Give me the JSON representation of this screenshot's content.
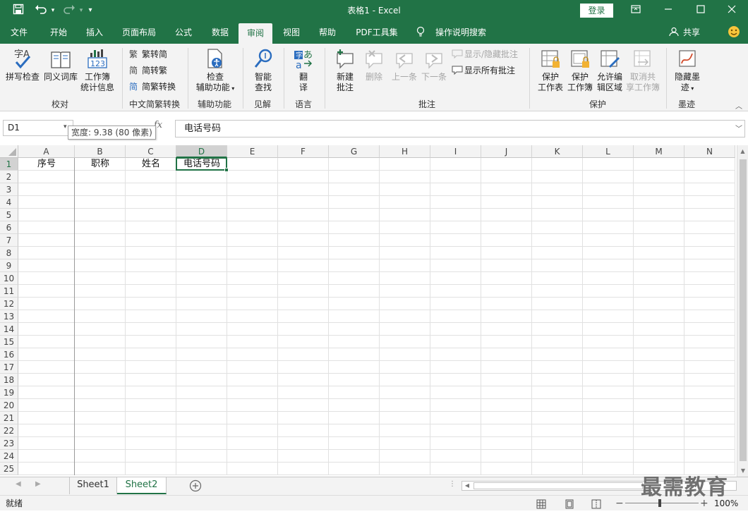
{
  "titlebar": {
    "title": "表格1 - Excel",
    "login": "登录",
    "qat": {
      "save_icon": "save-icon",
      "undo_icon": "undo-icon",
      "redo_icon": "redo-icon",
      "customize_icon": "qat-customize-icon"
    }
  },
  "tabs": [
    "文件",
    "开始",
    "插入",
    "页面布局",
    "公式",
    "数据",
    "审阅",
    "视图",
    "帮助",
    "PDF工具集",
    "操作说明搜索"
  ],
  "active_tab": "审阅",
  "share_label": "共享",
  "ribbon": {
    "proofing": {
      "label": "校对",
      "spell": "拼写检查",
      "thesaurus": "同义词库",
      "stats_line1": "工作簿",
      "stats_line2": "统计信息"
    },
    "chinese": {
      "label": "中文简繁转换",
      "to_simplified": "繁转简",
      "to_traditional": "简转繁",
      "convert": "简繁转换"
    },
    "accessibility": {
      "label": "辅助功能",
      "check_line1": "检查",
      "check_line2": "辅助功能"
    },
    "insights": {
      "label": "见解",
      "smart_line1": "智能",
      "smart_line2": "查找"
    },
    "language": {
      "label": "语言",
      "translate_line1": "翻",
      "translate_line2": "译"
    },
    "comments": {
      "label": "批注",
      "new_line1": "新建",
      "new_line2": "批注",
      "delete": "删除",
      "prev": "上一条",
      "next": "下一条",
      "show_hide": "显示/隐藏批注",
      "show_all": "显示所有批注"
    },
    "protect": {
      "label": "保护",
      "sheet_line1": "保护",
      "sheet_line2": "工作表",
      "book_line1": "保护",
      "book_line2": "工作簿",
      "allow_line1": "允许编",
      "allow_line2": "辑区域",
      "unshare_line1": "取消共",
      "unshare_line2": "享工作簿"
    },
    "ink": {
      "label": "墨迹",
      "hide_line1": "隐藏墨",
      "hide_line2": "迹"
    }
  },
  "formula_bar": {
    "name_box": "D1",
    "fx": "fx",
    "content": "电话号码"
  },
  "tooltip": {
    "text": "宽度: 9.38 (80 像素)"
  },
  "grid": {
    "columns": [
      "A",
      "B",
      "C",
      "D",
      "E",
      "F",
      "G",
      "H",
      "I",
      "J",
      "K",
      "L",
      "M",
      "N"
    ],
    "rows": [
      "1",
      "2",
      "3",
      "4",
      "5",
      "6",
      "7",
      "8",
      "9",
      "10",
      "11",
      "12",
      "13",
      "14",
      "15",
      "16",
      "17",
      "18",
      "19",
      "20",
      "21",
      "22",
      "23",
      "24",
      "25"
    ],
    "row1": [
      "序号",
      "职称",
      "姓名",
      "电话号码"
    ]
  },
  "sheets": [
    "Sheet1",
    "Sheet2"
  ],
  "active_sheet": "Sheet2",
  "status": {
    "ready": "就绪",
    "zoom": "100%"
  },
  "watermark": "最需教育",
  "colors": {
    "excel_green": "#217346",
    "ribbon_bg": "#f3f3f3"
  }
}
